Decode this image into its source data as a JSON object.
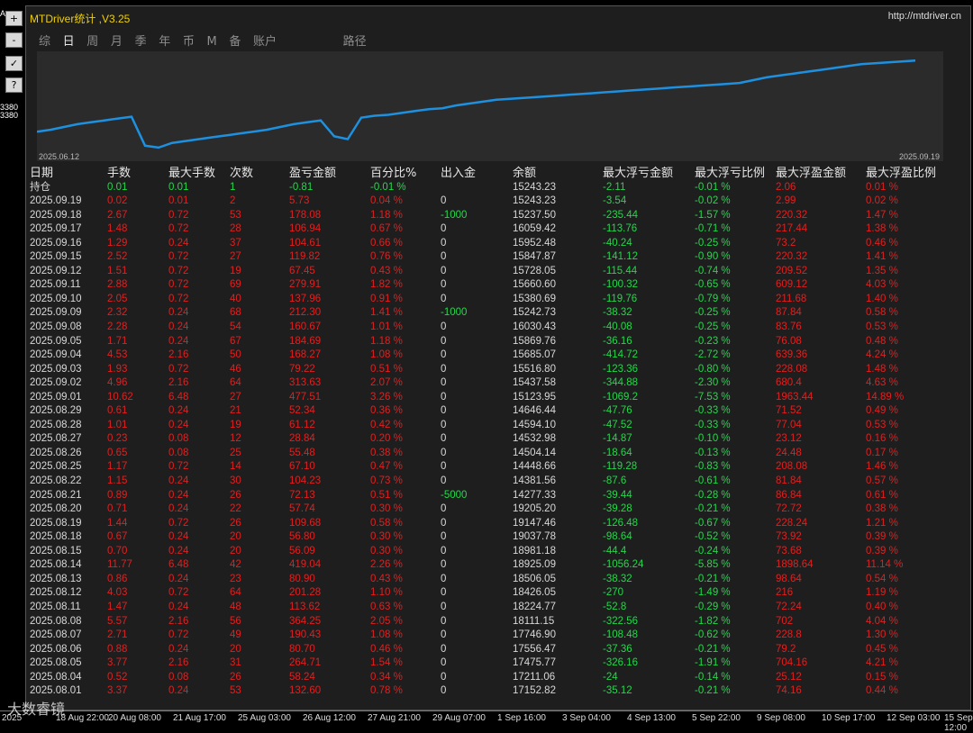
{
  "window": {
    "title": "MTDriver统计 ,V3.25",
    "url": "http://mtdriver.cn"
  },
  "left_strip": {
    "labels": [
      "A",
      "3380",
      "3380"
    ],
    "buttons": [
      "+",
      "-",
      "✓",
      "?"
    ]
  },
  "tabs": [
    "综",
    "日",
    "周",
    "月",
    "季",
    "年",
    "币",
    "M",
    "备",
    "账户"
  ],
  "active_tab": "日",
  "path_label": "路径",
  "equity_chart": {
    "start_label": "2025.06.12",
    "end_label": "2025.09.19",
    "line_color": "#1e90e0",
    "curve": [
      0.2,
      0.22,
      0.25,
      0.28,
      0.3,
      0.32,
      0.34,
      0.36,
      0.05,
      0.03,
      0.08,
      0.1,
      0.12,
      0.14,
      0.16,
      0.18,
      0.2,
      0.22,
      0.25,
      0.28,
      0.3,
      0.32,
      0.15,
      0.12,
      0.35,
      0.37,
      0.38,
      0.4,
      0.42,
      0.44,
      0.45,
      0.48,
      0.5,
      0.52,
      0.54,
      0.55,
      0.56,
      0.57,
      0.58,
      0.59,
      0.6,
      0.61,
      0.62,
      0.63,
      0.64,
      0.65,
      0.66,
      0.67,
      0.68,
      0.69,
      0.7,
      0.71,
      0.72,
      0.75,
      0.78,
      0.8,
      0.82,
      0.84,
      0.86,
      0.88,
      0.9,
      0.92,
      0.93,
      0.94,
      0.95,
      0.96
    ]
  },
  "table": {
    "headers": [
      "日期",
      "手数",
      "最大手数",
      "次数",
      "盈亏金额",
      "百分比%",
      "出入金",
      "余额",
      "最大浮亏金额",
      "最大浮亏比例",
      "最大浮盈金额",
      "最大浮盈比例"
    ],
    "holding": [
      "持仓",
      "0.01",
      "0.01",
      "1",
      "-0.81",
      "-0.01 %",
      "",
      "15243.23",
      "-2.11",
      "-0.01 %",
      "2.06",
      "0.01 %"
    ],
    "rows": [
      [
        "2025.09.19",
        "0.02",
        "0.01",
        "2",
        "5.73",
        "0.04 %",
        "0",
        "15243.23",
        "-3.54",
        "-0.02 %",
        "2.99",
        "0.02 %"
      ],
      [
        "2025.09.18",
        "2.67",
        "0.72",
        "53",
        "178.08",
        "1.18 %",
        "-1000",
        "15237.50",
        "-235.44",
        "-1.57 %",
        "220.32",
        "1.47 %"
      ],
      [
        "2025.09.17",
        "1.48",
        "0.72",
        "28",
        "106.94",
        "0.67 %",
        "0",
        "16059.42",
        "-113.76",
        "-0.71 %",
        "217.44",
        "1.38 %"
      ],
      [
        "2025.09.16",
        "1.29",
        "0.24",
        "37",
        "104.61",
        "0.66 %",
        "0",
        "15952.48",
        "-40.24",
        "-0.25 %",
        "73.2",
        "0.46 %"
      ],
      [
        "2025.09.15",
        "2.52",
        "0.72",
        "27",
        "119.82",
        "0.76 %",
        "0",
        "15847.87",
        "-141.12",
        "-0.90 %",
        "220.32",
        "1.41 %"
      ],
      [
        "2025.09.12",
        "1.51",
        "0.72",
        "19",
        "67.45",
        "0.43 %",
        "0",
        "15728.05",
        "-115.44",
        "-0.74 %",
        "209.52",
        "1.35 %"
      ],
      [
        "2025.09.11",
        "2.88",
        "0.72",
        "69",
        "279.91",
        "1.82 %",
        "0",
        "15660.60",
        "-100.32",
        "-0.65 %",
        "609.12",
        "4.03 %"
      ],
      [
        "2025.09.10",
        "2.05",
        "0.72",
        "40",
        "137.96",
        "0.91 %",
        "0",
        "15380.69",
        "-119.76",
        "-0.79 %",
        "211.68",
        "1.40 %"
      ],
      [
        "2025.09.09",
        "2.32",
        "0.24",
        "68",
        "212.30",
        "1.41 %",
        "-1000",
        "15242.73",
        "-38.32",
        "-0.25 %",
        "87.84",
        "0.58 %"
      ],
      [
        "2025.09.08",
        "2.28",
        "0.24",
        "54",
        "160.67",
        "1.01 %",
        "0",
        "16030.43",
        "-40.08",
        "-0.25 %",
        "83.76",
        "0.53 %"
      ],
      [
        "2025.09.05",
        "1.71",
        "0.24",
        "67",
        "184.69",
        "1.18 %",
        "0",
        "15869.76",
        "-36.16",
        "-0.23 %",
        "76.08",
        "0.48 %"
      ],
      [
        "2025.09.04",
        "4.53",
        "2.16",
        "50",
        "168.27",
        "1.08 %",
        "0",
        "15685.07",
        "-414.72",
        "-2.72 %",
        "639.36",
        "4.24 %"
      ],
      [
        "2025.09.03",
        "1.93",
        "0.72",
        "46",
        "79.22",
        "0.51 %",
        "0",
        "15516.80",
        "-123.36",
        "-0.80 %",
        "228.08",
        "1.48 %"
      ],
      [
        "2025.09.02",
        "4.96",
        "2.16",
        "64",
        "313.63",
        "2.07 %",
        "0",
        "15437.58",
        "-344.88",
        "-2.30 %",
        "680.4",
        "4.63 %"
      ],
      [
        "2025.09.01",
        "10.62",
        "6.48",
        "27",
        "477.51",
        "3.26 %",
        "0",
        "15123.95",
        "-1069.2",
        "-7.53 %",
        "1963.44",
        "14.89 %"
      ],
      [
        "2025.08.29",
        "0.61",
        "0.24",
        "21",
        "52.34",
        "0.36 %",
        "0",
        "14646.44",
        "-47.76",
        "-0.33 %",
        "71.52",
        "0.49 %"
      ],
      [
        "2025.08.28",
        "1.01",
        "0.24",
        "19",
        "61.12",
        "0.42 %",
        "0",
        "14594.10",
        "-47.52",
        "-0.33 %",
        "77.04",
        "0.53 %"
      ],
      [
        "2025.08.27",
        "0.23",
        "0.08",
        "12",
        "28.84",
        "0.20 %",
        "0",
        "14532.98",
        "-14.87",
        "-0.10 %",
        "23.12",
        "0.16 %"
      ],
      [
        "2025.08.26",
        "0.65",
        "0.08",
        "25",
        "55.48",
        "0.38 %",
        "0",
        "14504.14",
        "-18.64",
        "-0.13 %",
        "24.48",
        "0.17 %"
      ],
      [
        "2025.08.25",
        "1.17",
        "0.72",
        "14",
        "67.10",
        "0.47 %",
        "0",
        "14448.66",
        "-119.28",
        "-0.83 %",
        "208.08",
        "1.46 %"
      ],
      [
        "2025.08.22",
        "1.15",
        "0.24",
        "30",
        "104.23",
        "0.73 %",
        "0",
        "14381.56",
        "-87.6",
        "-0.61 %",
        "81.84",
        "0.57 %"
      ],
      [
        "2025.08.21",
        "0.89",
        "0.24",
        "26",
        "72.13",
        "0.51 %",
        "-5000",
        "14277.33",
        "-39.44",
        "-0.28 %",
        "86.84",
        "0.61 %"
      ],
      [
        "2025.08.20",
        "0.71",
        "0.24",
        "22",
        "57.74",
        "0.30 %",
        "0",
        "19205.20",
        "-39.28",
        "-0.21 %",
        "72.72",
        "0.38 %"
      ],
      [
        "2025.08.19",
        "1.44",
        "0.72",
        "26",
        "109.68",
        "0.58 %",
        "0",
        "19147.46",
        "-126.48",
        "-0.67 %",
        "228.24",
        "1.21 %"
      ],
      [
        "2025.08.18",
        "0.67",
        "0.24",
        "20",
        "56.80",
        "0.30 %",
        "0",
        "19037.78",
        "-98.64",
        "-0.52 %",
        "73.92",
        "0.39 %"
      ],
      [
        "2025.08.15",
        "0.70",
        "0.24",
        "20",
        "56.09",
        "0.30 %",
        "0",
        "18981.18",
        "-44.4",
        "-0.24 %",
        "73.68",
        "0.39 %"
      ],
      [
        "2025.08.14",
        "11.77",
        "6.48",
        "42",
        "419.04",
        "2.26 %",
        "0",
        "18925.09",
        "-1056.24",
        "-5.85 %",
        "1898.64",
        "11.14 %"
      ],
      [
        "2025.08.13",
        "0.86",
        "0.24",
        "23",
        "80.90",
        "0.43 %",
        "0",
        "18506.05",
        "-38.32",
        "-0.21 %",
        "98.64",
        "0.54 %"
      ],
      [
        "2025.08.12",
        "4.03",
        "0.72",
        "64",
        "201.28",
        "1.10 %",
        "0",
        "18426.05",
        "-270",
        "-1.49 %",
        "216",
        "1.19 %"
      ],
      [
        "2025.08.11",
        "1.47",
        "0.24",
        "48",
        "113.62",
        "0.63 %",
        "0",
        "18224.77",
        "-52.8",
        "-0.29 %",
        "72.24",
        "0.40 %"
      ],
      [
        "2025.08.08",
        "5.57",
        "2.16",
        "56",
        "364.25",
        "2.05 %",
        "0",
        "18111.15",
        "-322.56",
        "-1.82 %",
        "702",
        "4.04 %"
      ],
      [
        "2025.08.07",
        "2.71",
        "0.72",
        "49",
        "190.43",
        "1.08 %",
        "0",
        "17746.90",
        "-108.48",
        "-0.62 %",
        "228.8",
        "1.30 %"
      ],
      [
        "2025.08.06",
        "0.88",
        "0.24",
        "20",
        "80.70",
        "0.46 %",
        "0",
        "17556.47",
        "-37.36",
        "-0.21 %",
        "79.2",
        "0.45 %"
      ],
      [
        "2025.08.05",
        "3.77",
        "2.16",
        "31",
        "264.71",
        "1.54 %",
        "0",
        "17475.77",
        "-326.16",
        "-1.91 %",
        "704.16",
        "4.21 %"
      ],
      [
        "2025.08.04",
        "0.52",
        "0.08",
        "26",
        "58.24",
        "0.34 %",
        "0",
        "17211.06",
        "-24",
        "-0.14 %",
        "25.12",
        "0.15 %"
      ],
      [
        "2025.08.01",
        "3.37",
        "0.24",
        "53",
        "132.60",
        "0.78 %",
        "0",
        "17152.82",
        "-35.12",
        "-0.21 %",
        "74.16",
        "0.44 %"
      ]
    ]
  },
  "time_axis": [
    "2025",
    "18 Aug 22:00",
    "20 Aug 08:00",
    "21 Aug 17:00",
    "25 Aug 03:00",
    "26 Aug 12:00",
    "27 Aug 21:00",
    "29 Aug 07:00",
    "1 Sep 16:00",
    "3 Sep 04:00",
    "4 Sep 13:00",
    "5 Sep 22:00",
    "9 Sep 08:00",
    "10 Sep 17:00",
    "12 Sep 03:00",
    "15 Sep 12:00"
  ],
  "watermark": "大数睿镜"
}
